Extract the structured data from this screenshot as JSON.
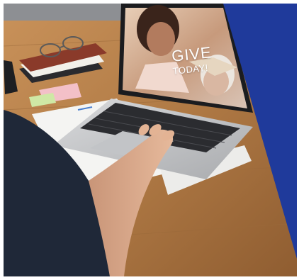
{
  "photo": {
    "subject": "person-using-laptop-donation-page",
    "screen_headline": {
      "line1": "GIVE",
      "line2": "TODAY!"
    },
    "colors": {
      "accent_panel": "#1f3a9b",
      "table_wood": "#b07a45",
      "notebook_cover": "#8a3a2a"
    }
  }
}
